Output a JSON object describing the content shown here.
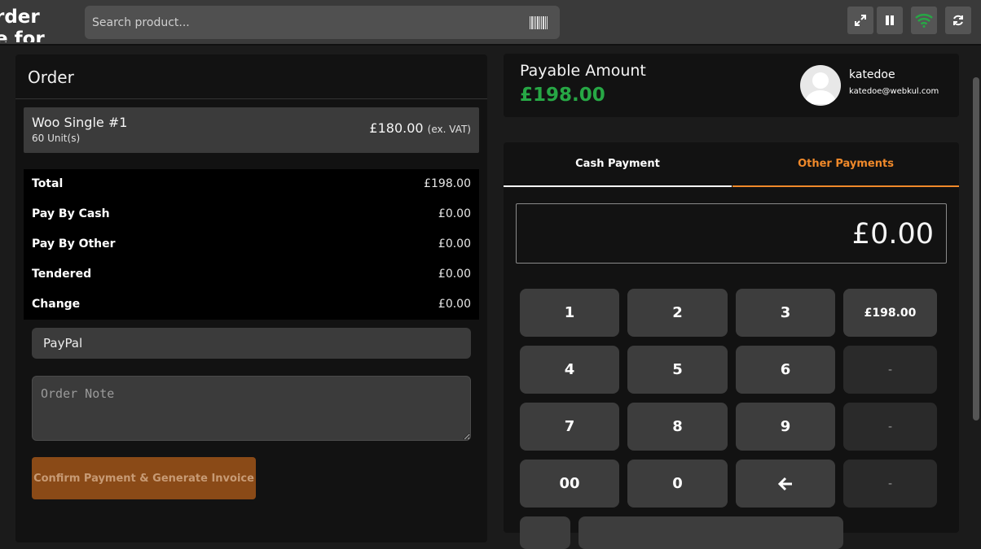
{
  "header": {
    "brand_line1": "rder",
    "brand_line2": "e for",
    "search_placeholder": "Search product...",
    "icons": [
      "barcode-icon",
      "fullscreen-icon",
      "pause-icon",
      "wifi-icon",
      "refresh-icon"
    ],
    "wifi_color": "#27a745"
  },
  "order": {
    "title": "Order",
    "item": {
      "name": "Woo Single #1",
      "qty": "60 Unit(s)",
      "price": "£180.00",
      "vat": "(ex. VAT)"
    },
    "summary": [
      {
        "label": "Total",
        "value": "£198.00"
      },
      {
        "label": "Pay By Cash",
        "value": "£0.00"
      },
      {
        "label": "Pay By Other",
        "value": "£0.00"
      },
      {
        "label": "Tendered",
        "value": "£0.00"
      },
      {
        "label": "Change",
        "value": "£0.00"
      }
    ],
    "payment_method": "PayPal",
    "note_placeholder": "Order Note",
    "confirm_label": "Confirm Payment & Generate Invoice"
  },
  "payable": {
    "label": "Payable Amount",
    "amount": "£198.00",
    "amount_color": "#27a745",
    "user_name": "katedoe",
    "user_email": "katedoe@webkul.com"
  },
  "payment": {
    "tabs": {
      "cash": "Cash Payment",
      "other": "Other Payments"
    },
    "active_color": "#f0892a",
    "display_value": "£0.00",
    "keys": {
      "k1": "1",
      "k2": "2",
      "k3": "3",
      "quick": "£198.00",
      "k4": "4",
      "k5": "5",
      "k6": "6",
      "d1": "-",
      "k7": "7",
      "k8": "8",
      "k9": "9",
      "d2": "-",
      "k00": "00",
      "k0": "0",
      "back": "🡐",
      "d3": "-"
    }
  }
}
